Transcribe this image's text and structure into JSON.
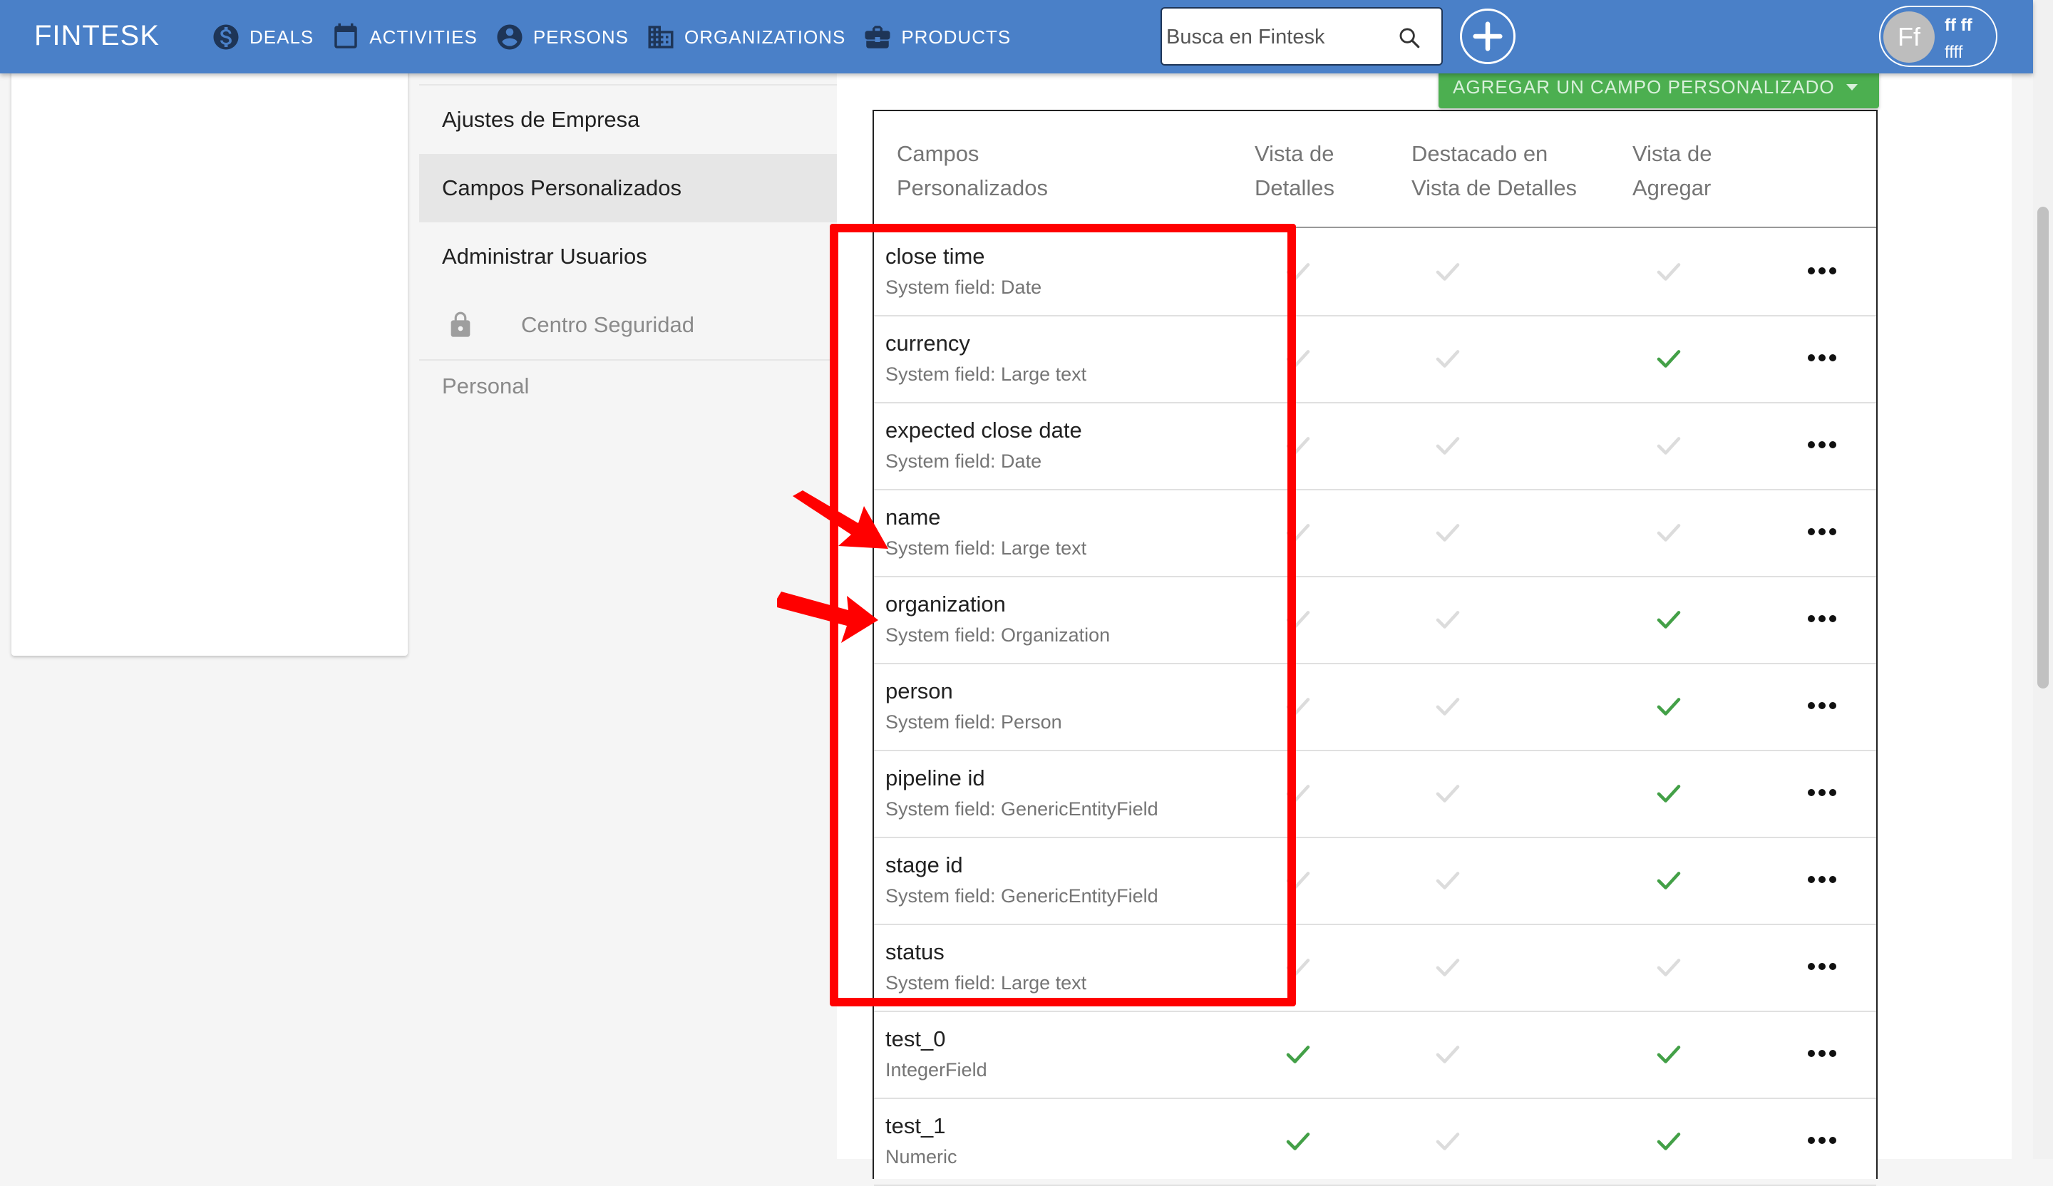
{
  "appbar": {
    "brand": "FINTESK",
    "nav": [
      {
        "label": "DEALS",
        "icon": "dollar-circle-icon"
      },
      {
        "label": "ACTIVITIES",
        "icon": "calendar-icon"
      },
      {
        "label": "PERSONS",
        "icon": "account-circle-icon"
      },
      {
        "label": "ORGANIZATIONS",
        "icon": "building-icon"
      },
      {
        "label": "PRODUCTS",
        "icon": "briefcase-icon"
      }
    ],
    "search_placeholder": "Busca en Fintesk",
    "user": {
      "initials": "Ff",
      "name": "ff ff",
      "sub": "ffff"
    }
  },
  "settings_menu": {
    "items": [
      {
        "label": "Ajustes de Empresa",
        "active": false
      },
      {
        "label": "Campos Personalizados",
        "active": true
      },
      {
        "label": "Administrar Usuarios",
        "active": false
      },
      {
        "label": "Centro Seguridad",
        "locked": true
      }
    ],
    "group_label": "Personal"
  },
  "add_field_button": "AGREGAR UN CAMPO PERSONALIZADO",
  "table": {
    "headers": {
      "name_col": [
        "Campos",
        "Personalizados"
      ],
      "details_col": [
        "Vista de",
        "Detalles"
      ],
      "featured_col": [
        "Destacado en",
        "Vista de Detalles"
      ],
      "add_col": [
        "Vista de",
        "Agregar"
      ]
    },
    "rows": [
      {
        "name": "close time",
        "type": "System field: Date",
        "details": false,
        "featured": false,
        "add": false
      },
      {
        "name": "currency",
        "type": "System field: Large text",
        "details": false,
        "featured": false,
        "add": true
      },
      {
        "name": "expected close date",
        "type": "System field: Date",
        "details": false,
        "featured": false,
        "add": false
      },
      {
        "name": "name",
        "type": "System field: Large text",
        "details": false,
        "featured": false,
        "add": false
      },
      {
        "name": "organization",
        "type": "System field: Organization",
        "details": false,
        "featured": false,
        "add": true
      },
      {
        "name": "person",
        "type": "System field: Person",
        "details": false,
        "featured": false,
        "add": true
      },
      {
        "name": "pipeline id",
        "type": "System field: GenericEntityField",
        "details": false,
        "featured": false,
        "add": true
      },
      {
        "name": "stage id",
        "type": "System field: GenericEntityField",
        "details": false,
        "featured": false,
        "add": true
      },
      {
        "name": "status",
        "type": "System field: Large text",
        "details": false,
        "featured": false,
        "add": false
      },
      {
        "name": "test_0",
        "type": "IntegerField",
        "details": true,
        "featured": false,
        "add": true
      },
      {
        "name": "test_1",
        "type": "Numeric",
        "details": true,
        "featured": false,
        "add": true
      }
    ]
  },
  "colors": {
    "appbar": "#4a80c8",
    "check_on": "#43a047",
    "check_off": "#dcdcdc",
    "add_button": "#4caf50",
    "annotation": "#ff0000"
  }
}
